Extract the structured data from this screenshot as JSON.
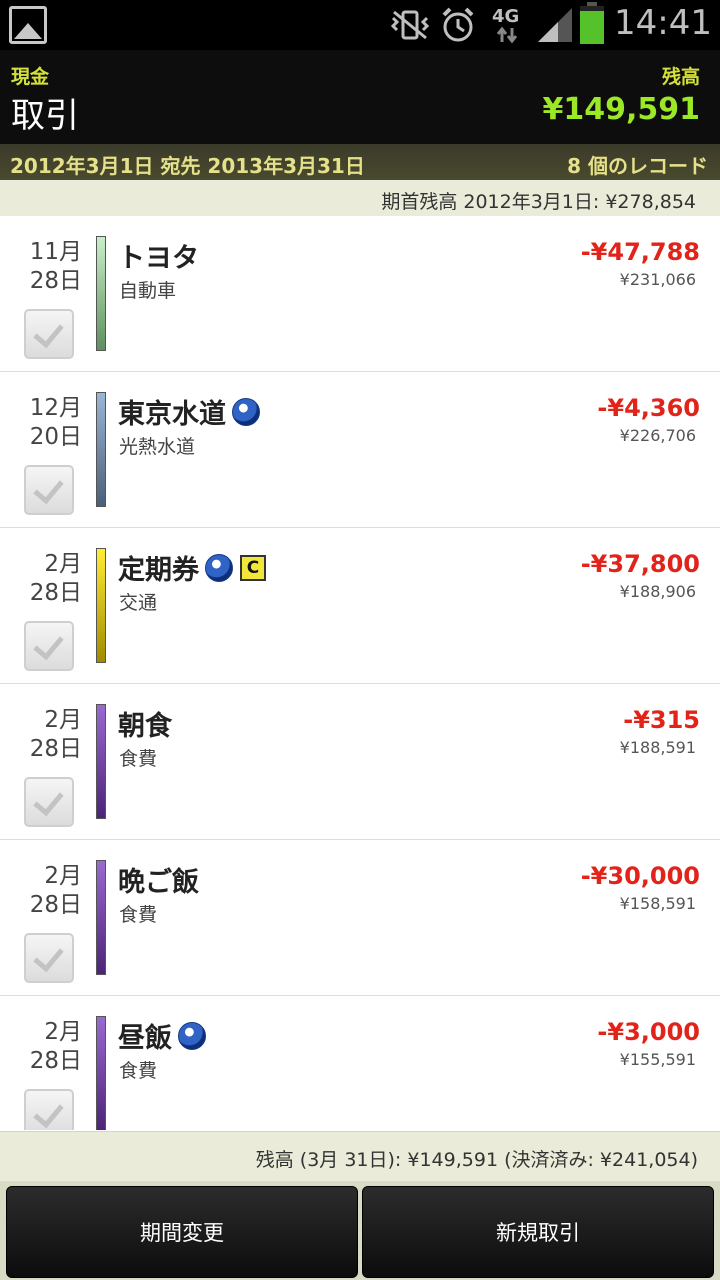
{
  "status_bar": {
    "network": "4G",
    "time": "14:41"
  },
  "header": {
    "account_label": "現金",
    "title": "取引",
    "balance_label": "残高",
    "balance_value": "¥149,591"
  },
  "range": {
    "text": "2012年3月1日 宛先 2013年3月31日",
    "count": "8 個のレコード"
  },
  "opening_balance": "期首残高 2012年3月1日: ¥278,854",
  "transactions": [
    {
      "month": "11月",
      "day": "28日",
      "payee": "トヨタ",
      "category": "自動車",
      "amount": "-¥47,788",
      "running": "¥231,066",
      "color": "#8fc48f",
      "repeat": false,
      "cleared_c": false
    },
    {
      "month": "12月",
      "day": "20日",
      "payee": "東京水道",
      "category": "光熱水道",
      "amount": "-¥4,360",
      "running": "¥226,706",
      "color": "#6d86a8",
      "repeat": true,
      "cleared_c": false
    },
    {
      "month": "2月",
      "day": "28日",
      "payee": "定期券",
      "category": "交通",
      "amount": "-¥37,800",
      "running": "¥188,906",
      "color": "#d4c400",
      "repeat": true,
      "cleared_c": true,
      "c_label": "C"
    },
    {
      "month": "2月",
      "day": "28日",
      "payee": "朝食",
      "category": "食費",
      "amount": "-¥315",
      "running": "¥188,591",
      "color": "#6b3a9a",
      "repeat": false,
      "cleared_c": false
    },
    {
      "month": "2月",
      "day": "28日",
      "payee": "晩ご飯",
      "category": "食費",
      "amount": "-¥30,000",
      "running": "¥158,591",
      "color": "#6b3a9a",
      "repeat": false,
      "cleared_c": false
    },
    {
      "month": "2月",
      "day": "28日",
      "payee": "昼飯",
      "category": "食費",
      "amount": "-¥3,000",
      "running": "¥155,591",
      "color": "#6b3a9a",
      "repeat": true,
      "cleared_c": false
    }
  ],
  "footer": {
    "summary": "残高 (3月 31日): ¥149,591 (決済済み: ¥241,054)"
  },
  "buttons": {
    "change_period": "期間変更",
    "new_transaction": "新規取引"
  },
  "colors": {
    "amount_negative": "#e2231a",
    "balance_positive": "#9be827",
    "header_label": "#d4e03a"
  }
}
